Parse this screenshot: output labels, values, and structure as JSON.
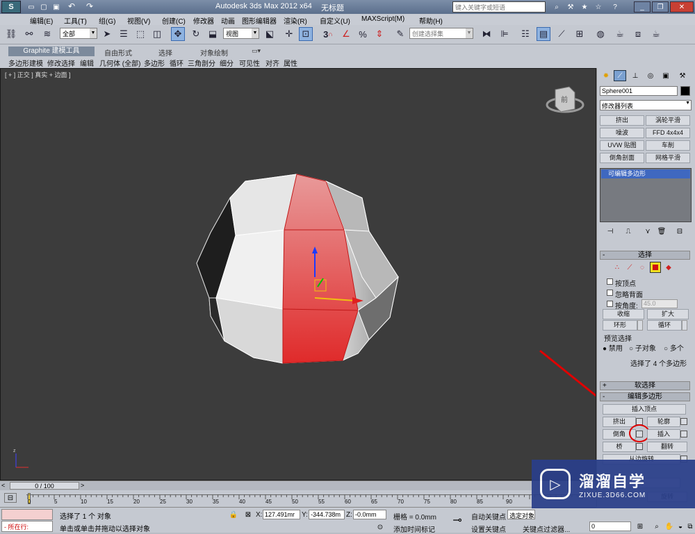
{
  "title": {
    "app": "Autodesk 3ds Max  2012 x64",
    "doc": "无标题",
    "search_placeholder": "键入关键字或短语"
  },
  "menu": [
    "编辑(E)",
    "工具(T)",
    "组(G)",
    "视图(V)",
    "创建(C)",
    "修改器",
    "动画",
    "图形编辑器",
    "渲染(R)",
    "自定义(U)",
    "MAXScript(M)",
    "帮助(H)"
  ],
  "toolbar": {
    "selection_filter": "全部",
    "ref_coord": "视图",
    "snap_label": "3",
    "percent_label": "%",
    "named_selection": "创建选择集"
  },
  "ribbon": {
    "tabs": [
      "Graphite 建模工具",
      "自由形式",
      "选择",
      "对象绘制"
    ],
    "sub": [
      "多边形建模",
      "修改选择",
      "编辑",
      "几何体 (全部)",
      "多边形",
      "循环",
      "三角剖分",
      "细分",
      "可见性",
      "对齐",
      "属性"
    ]
  },
  "viewport": {
    "label": "[ + ] 正交 ] 真实 + 边面 ]",
    "viewcube_label": "前"
  },
  "command_panel": {
    "object_name": "Sphere001",
    "modifier_list": "修改器列表",
    "modifier_buttons": [
      "挤出",
      "涡轮平滑",
      "噪波",
      "FFD 4x4x4",
      "UVW 贴图",
      "车削",
      "倒角剖面",
      "网格平滑"
    ],
    "stack_item": "可编辑多边形",
    "selection": {
      "header": "选择",
      "by_vertex": "按顶点",
      "ignore_backfacing": "忽略背面",
      "by_angle": "按角度:",
      "angle_value": "45.0",
      "shrink": "收缩",
      "grow": "扩大",
      "ring": "环形",
      "loop": "循环",
      "preview": "预览选择",
      "disabled": "禁用",
      "subobj": "子对象",
      "multi": "多个",
      "status": "选择了 4 个多边形"
    },
    "soft_selection": "软选择",
    "edit_polygons": "编辑多边形",
    "insert_vertex": "插入顶点",
    "extrude": "挤出",
    "outline": "轮廓",
    "bevel": "倒角",
    "inset": "插入",
    "bridge": "桥",
    "flip": "翻转",
    "hinge": "从边旋转",
    "rotate": "旋转",
    "partial_2": "分"
  },
  "timeline": {
    "frame": "0 / 100",
    "ticks": [
      "0",
      "5",
      "10",
      "15",
      "20",
      "25",
      "30",
      "35",
      "40",
      "45",
      "50",
      "55",
      "60",
      "65",
      "70",
      "75",
      "80",
      "85",
      "90"
    ]
  },
  "status": {
    "running": "所在行:",
    "selected": "选择了 1 个 对象",
    "hint": "单击或单击并拖动以选择对象",
    "x_label": "X:",
    "x": "127.491mr",
    "y_label": "Y:",
    "y": "-344.738m",
    "z_label": "Z:",
    "z": "-0.0mm",
    "grid": "栅格 = 0.0mm",
    "add_time_tag": "添加时间标记",
    "auto_key": "自动关键点",
    "set_key": "设置关键点",
    "selected_obj": "选定对象",
    "key_filters": "关键点过滤器...",
    "frame_field": "0"
  },
  "watermark": {
    "brand": "溜溜自学",
    "url": "ZIXUE.3D66.COM"
  },
  "colors": {
    "selection_red": "#e8353a",
    "panel": "#c5c9d1",
    "viewport_bg": "#3c3c3c",
    "watermark_bg": "#2a3f8a"
  }
}
